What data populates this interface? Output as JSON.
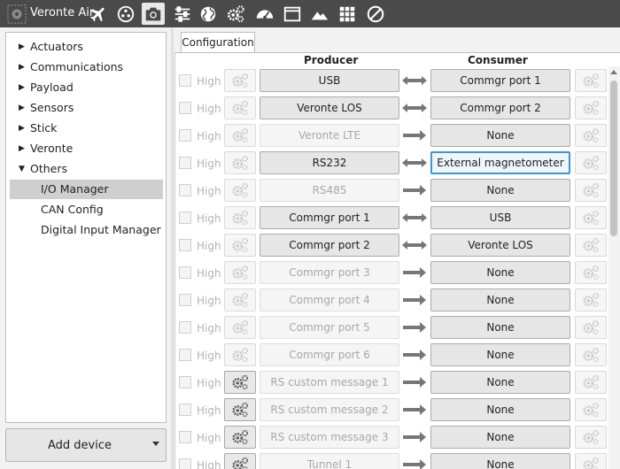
{
  "app": {
    "name": "Veronte Air"
  },
  "toolbar": {
    "icons": [
      "gear-chip-icon",
      "airplane-icon",
      "joystick-icon",
      "camera-icon",
      "sliders-icon",
      "globe-icon",
      "gears-icon",
      "gauge-icon",
      "window-icon",
      "mountain-icon",
      "grid-icon",
      "block-icon"
    ],
    "active_icon": "camera-icon"
  },
  "sidebar": {
    "items": [
      {
        "label": "Actuators",
        "expanded": false
      },
      {
        "label": "Communications",
        "expanded": false
      },
      {
        "label": "Payload",
        "expanded": false
      },
      {
        "label": "Sensors",
        "expanded": false
      },
      {
        "label": "Stick",
        "expanded": false
      },
      {
        "label": "Veronte",
        "expanded": false
      },
      {
        "label": "Others",
        "expanded": true
      }
    ],
    "children": [
      {
        "label": "I/O Manager",
        "selected": true
      },
      {
        "label": "CAN Config",
        "selected": false
      },
      {
        "label": "Digital Input Manager",
        "selected": false
      }
    ],
    "add_device": "Add device"
  },
  "tabs": {
    "configuration": "Configuration"
  },
  "table": {
    "producer_header": "Producer",
    "consumer_header": "Consumer",
    "high_label": "High",
    "rows": [
      {
        "producer": "USB",
        "consumer": "Commgr port 1",
        "bidirectional": true,
        "producer_enabled": true,
        "producer_settings": false,
        "consumer_focused": false
      },
      {
        "producer": "Veronte LOS",
        "consumer": "Commgr port 2",
        "bidirectional": true,
        "producer_enabled": true,
        "producer_settings": false,
        "consumer_focused": false
      },
      {
        "producer": "Veronte LTE",
        "consumer": "None",
        "bidirectional": false,
        "producer_enabled": false,
        "producer_settings": false,
        "consumer_focused": false
      },
      {
        "producer": "RS232",
        "consumer": "External magnetometer",
        "bidirectional": true,
        "producer_enabled": true,
        "producer_settings": false,
        "consumer_focused": true
      },
      {
        "producer": "RS485",
        "consumer": "None",
        "bidirectional": false,
        "producer_enabled": false,
        "producer_settings": false,
        "consumer_focused": false
      },
      {
        "producer": "Commgr port 1",
        "consumer": "USB",
        "bidirectional": true,
        "producer_enabled": true,
        "producer_settings": false,
        "consumer_focused": false
      },
      {
        "producer": "Commgr port 2",
        "consumer": "Veronte LOS",
        "bidirectional": true,
        "producer_enabled": true,
        "producer_settings": false,
        "consumer_focused": false
      },
      {
        "producer": "Commgr port 3",
        "consumer": "None",
        "bidirectional": false,
        "producer_enabled": false,
        "producer_settings": false,
        "consumer_focused": false
      },
      {
        "producer": "Commgr port 4",
        "consumer": "None",
        "bidirectional": false,
        "producer_enabled": false,
        "producer_settings": false,
        "consumer_focused": false
      },
      {
        "producer": "Commgr port 5",
        "consumer": "None",
        "bidirectional": false,
        "producer_enabled": false,
        "producer_settings": false,
        "consumer_focused": false
      },
      {
        "producer": "Commgr port 6",
        "consumer": "None",
        "bidirectional": false,
        "producer_enabled": false,
        "producer_settings": false,
        "consumer_focused": false
      },
      {
        "producer": "RS custom message 1",
        "consumer": "None",
        "bidirectional": false,
        "producer_enabled": false,
        "producer_settings": true,
        "consumer_focused": false
      },
      {
        "producer": "RS custom message 2",
        "consumer": "None",
        "bidirectional": false,
        "producer_enabled": false,
        "producer_settings": true,
        "consumer_focused": false
      },
      {
        "producer": "RS custom message 3",
        "consumer": "None",
        "bidirectional": false,
        "producer_enabled": false,
        "producer_settings": true,
        "consumer_focused": false
      },
      {
        "producer": "Tunnel 1",
        "consumer": "None",
        "bidirectional": false,
        "producer_enabled": false,
        "producer_settings": true,
        "consumer_focused": false
      }
    ]
  },
  "colors": {
    "toolbar_bg": "#4a4a4a",
    "focus_border": "#3d95d6",
    "arrow": "#777777"
  }
}
